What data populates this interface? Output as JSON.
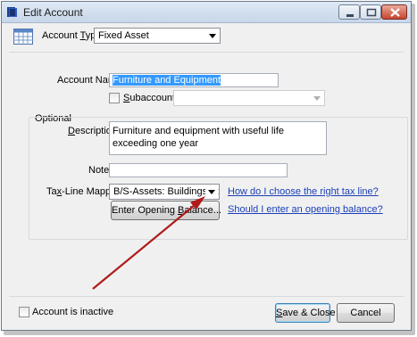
{
  "window": {
    "title": "Edit Account",
    "controls": {
      "minimize": "minimize",
      "maximize": "maximize",
      "close": "close"
    }
  },
  "account_type": {
    "label_pre": "Account ",
    "label_u": "T",
    "label_post": "ype",
    "value": "Fixed Asset"
  },
  "account_name": {
    "label_pre": "Account Nam",
    "label_u": "e",
    "value": "Furniture and Equipment"
  },
  "subaccount": {
    "label_u": "S",
    "label_post": "ubaccount of",
    "value": "",
    "checked": false
  },
  "optional": {
    "heading": "Optional",
    "description_label_pre": "",
    "description_label_u": "D",
    "description_label_post": "escription",
    "description_value": "Furniture and equipment with useful life exceeding one year",
    "note_label": "Note",
    "note_value": "",
    "tax_line_label_pre": "Ta",
    "tax_line_label_u": "x",
    "tax_line_label_post": "-Line Mapping",
    "tax_line_value": "B/S-Assets: Buildings/oth. ...",
    "tax_help_link": "How do I choose the right tax line?",
    "opening_balance_pre": "Enter Opening ",
    "opening_balance_u": "B",
    "opening_balance_post": "alance...",
    "opening_help_link": "Should I enter an opening balance?"
  },
  "footer": {
    "inactive_label": "Account is inactive",
    "inactive_checked": false,
    "save_pre": "",
    "save_u": "S",
    "save_post": "ave & Close",
    "cancel_label": "Cancel"
  },
  "colors": {
    "link": "#1a3fb8",
    "selection": "#3399ff",
    "annotation_arrow": "#b01a1a"
  },
  "icons": [
    "app-icon",
    "account-type-icon",
    "chevron-down-icon",
    "red-arrow-annotation"
  ]
}
